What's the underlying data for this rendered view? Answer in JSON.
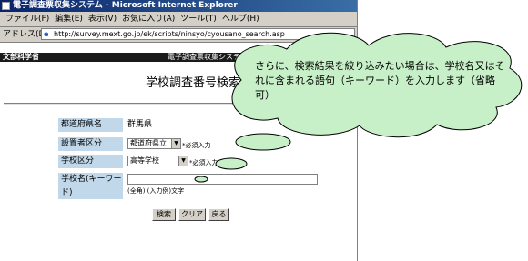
{
  "window": {
    "title": "電子調査票収集システム - Microsoft Internet Explorer",
    "menus": [
      "ファイル(F)",
      "編集(E)",
      "表示(V)",
      "お気に入り(A)",
      "ツール(T)",
      "ヘルプ(H)"
    ],
    "address_label": "アドレス(D)",
    "address_value": "http://survey.mext.go.jp/ek/scripts/ninsyo/cyousano_search.asp"
  },
  "header": {
    "left": "文部科学省",
    "right": "電子調査票収集システム"
  },
  "page": {
    "title": "学校調査番号検索"
  },
  "form": {
    "prefecture_label": "都道府県名",
    "prefecture_value": "群馬県",
    "founder_label": "設置者区分",
    "founder_value": "都道府県立",
    "founder_required": "*必須入力",
    "school_type_label": "学校区分",
    "school_type_value": "高等学校",
    "school_type_required": "*必須入力",
    "school_name_label": "学校名(キーワード)",
    "school_name_value": "",
    "school_name_hint": "(全角) (入力例)文字"
  },
  "buttons": {
    "search": "検索",
    "clear": "クリア",
    "back": "戻る"
  },
  "callout": {
    "text": "さらに、検索結果を絞り込みたい場合は、学校名又はそれに含まれる語句（キーワード）を入力します（省略可）"
  },
  "colors": {
    "label_bg": "#c0d8ea",
    "callout_fill": "#c8f0c8",
    "title_bar": "#0a246a"
  }
}
